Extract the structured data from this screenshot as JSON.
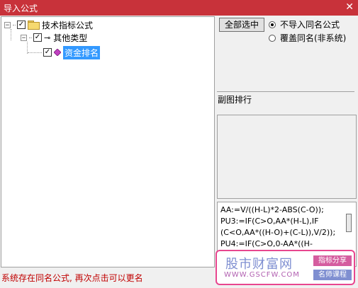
{
  "window": {
    "title": "导入公式",
    "close_glyph": "✕"
  },
  "tree": {
    "root": {
      "label": "技术指标公式",
      "checked": true,
      "expanded": true
    },
    "group": {
      "label": "其他类型",
      "checked": true,
      "expanded": true
    },
    "item": {
      "label": "资金排名",
      "checked": true,
      "selected": true
    }
  },
  "buttons": {
    "select_all": "全部选中"
  },
  "options": [
    {
      "label": "不导入同名公式",
      "selected": true
    },
    {
      "label": "覆盖同名(非系统)",
      "selected": false
    }
  ],
  "caption": "副图排行",
  "code_lines": [
    "AA:=V/((H-L)*2-ABS(C-O));",
    "PU3:=IF(C>O,AA*(H-L),IF",
    "(C<O,AA*((H-O)+(C-L)),V/2));",
    "PU4:=IF(C>O,0-AA*((H-"
  ],
  "status_text": "系统存在同名公式, 再次点击可以更名",
  "watermark": {
    "logo": "股市财富网",
    "url": "WWW.GSCFW.COM",
    "badge1": "指标分享",
    "badge2": "名师课程"
  },
  "colors": {
    "titlebar": "#c8323a",
    "selection": "#3399ff",
    "status": "#c00000",
    "watermark_border": "#e8468f"
  }
}
